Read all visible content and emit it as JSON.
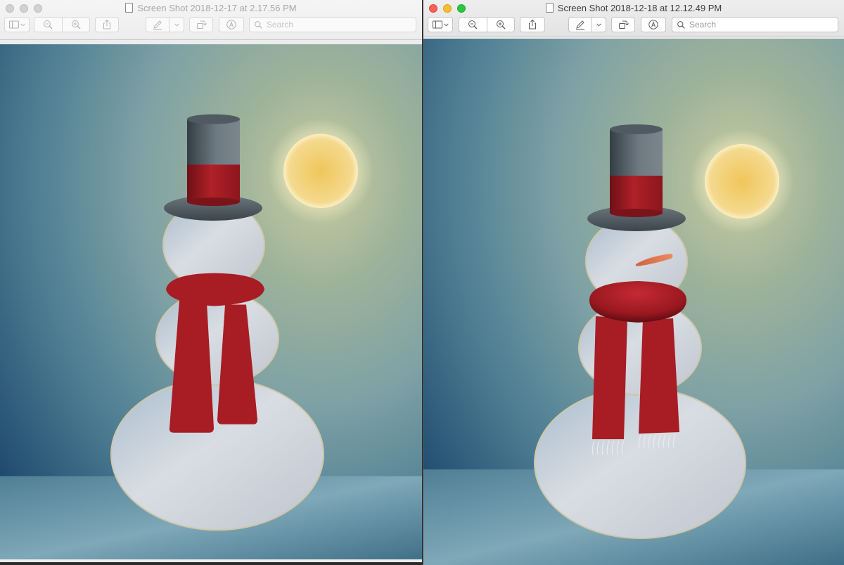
{
  "windows": [
    {
      "title": "Screen Shot 2018-12-17 at 2.17.56 PM",
      "active": false,
      "search_placeholder": "Search",
      "image": "snowman without nose, scarf wrapped around neck with straight ends",
      "snowman": {
        "has_nose": false,
        "scarf_fringe": false
      }
    },
    {
      "title": "Screen Shot 2018-12-18 at 12.12.49 PM",
      "active": true,
      "search_placeholder": "Search",
      "image": "snowman with carrot nose, thicker scarf with fringed ends",
      "snowman": {
        "has_nose": true,
        "scarf_fringe": true
      }
    }
  ],
  "colors": {
    "scarf": "#a81c24",
    "hat": "#4f5a62",
    "hat_band": "#a11a22",
    "sun": "#f0c65a",
    "ground": "#6a93a6",
    "snow": "#c7cdd6",
    "nose": "#e0744e"
  },
  "icons": [
    "sidebar-icon",
    "chevron-down-icon",
    "zoom-out-icon",
    "zoom-in-icon",
    "share-icon",
    "pen-icon",
    "rotate-icon",
    "markup-icon",
    "search-icon"
  ]
}
